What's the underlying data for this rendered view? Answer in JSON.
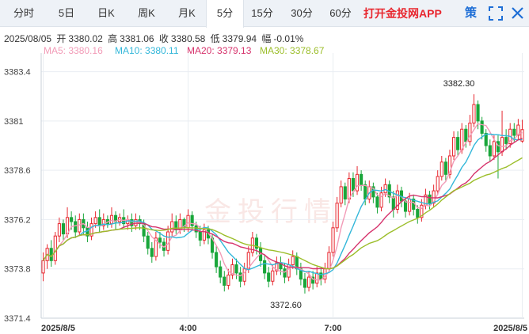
{
  "tabs": [
    "分时",
    "5日",
    "日K",
    "周K",
    "月K",
    "5分",
    "15分",
    "30分",
    "60分"
  ],
  "active_tab": "5分",
  "app_link": "打开金投网APP",
  "strategy_label": "策",
  "icons": {
    "fullscreen": "fullscreen-icon",
    "close": "close-icon"
  },
  "info": {
    "date": "2025/08/05",
    "open_label": "开",
    "open": "3380.02",
    "high_label": "高",
    "high": "3381.06",
    "close_label": "收",
    "close": "3380.58",
    "low_label": "低",
    "low": "3379.94",
    "change_label": "幅",
    "change": "-0.01%"
  },
  "ma": [
    {
      "label": "MA5:",
      "value": "3380.16",
      "color": "#f29bb7"
    },
    {
      "label": "MA10:",
      "value": "3380.11",
      "color": "#33b7d9"
    },
    {
      "label": "MA20:",
      "value": "3379.13",
      "color": "#d6336c"
    },
    {
      "label": "MA30:",
      "value": "3378.67",
      "color": "#9cbe2a"
    }
  ],
  "watermark": "金投行情",
  "colors": {
    "up": "#e8262e",
    "down": "#19a63a",
    "grid": "#e9edf2",
    "accent": "#1f6fd6"
  },
  "chart_data": {
    "type": "candlestick",
    "ylim": [
      3371.4,
      3384.0
    ],
    "y_ticks": [
      3383.4,
      3381,
      3378.6,
      3376.2,
      3373.8,
      3371.4
    ],
    "x_ticks": [
      {
        "label": "2025/8/5",
        "index": 0
      },
      {
        "label": "4:00",
        "index": 36
      },
      {
        "label": "7:00",
        "index": 72
      },
      {
        "label": "2025/8/5",
        "index": 119
      }
    ],
    "annotations": [
      {
        "text": "3382.30",
        "index": 108,
        "value": 3382.3,
        "side": "top"
      },
      {
        "text": "3372.60",
        "index": 65,
        "value": 3372.6,
        "side": "bottom"
      }
    ],
    "candles": [
      [
        3373.6,
        3374.2,
        3374.6,
        3373.2
      ],
      [
        3374.2,
        3374.8,
        3375.0,
        3373.8
      ],
      [
        3374.8,
        3374.2,
        3375.2,
        3373.9
      ],
      [
        3374.2,
        3375.4,
        3375.6,
        3374.0
      ],
      [
        3375.4,
        3376.0,
        3376.3,
        3375.1
      ],
      [
        3376.0,
        3375.5,
        3376.2,
        3375.2
      ],
      [
        3375.5,
        3376.3,
        3376.8,
        3375.3
      ],
      [
        3376.3,
        3376.1,
        3376.6,
        3375.7
      ],
      [
        3376.1,
        3375.6,
        3376.4,
        3375.3
      ],
      [
        3375.6,
        3376.2,
        3376.5,
        3375.4
      ],
      [
        3376.2,
        3375.8,
        3376.5,
        3375.5
      ],
      [
        3375.8,
        3375.4,
        3376.1,
        3375.1
      ],
      [
        3375.4,
        3376.0,
        3376.3,
        3375.2
      ],
      [
        3376.0,
        3376.3,
        3376.6,
        3375.8
      ],
      [
        3376.3,
        3375.9,
        3376.7,
        3375.6
      ],
      [
        3375.9,
        3376.2,
        3376.5,
        3375.7
      ],
      [
        3376.2,
        3376.0,
        3376.4,
        3375.8
      ],
      [
        3376.0,
        3376.4,
        3376.8,
        3375.8
      ],
      [
        3376.4,
        3376.1,
        3376.6,
        3375.7
      ],
      [
        3376.1,
        3376.3,
        3376.5,
        3375.9
      ],
      [
        3376.3,
        3376.0,
        3376.7,
        3375.8
      ],
      [
        3376.0,
        3376.2,
        3376.4,
        3375.7
      ],
      [
        3376.2,
        3375.9,
        3376.5,
        3375.6
      ],
      [
        3375.9,
        3376.2,
        3376.5,
        3375.7
      ],
      [
        3376.2,
        3376.0,
        3376.4,
        3375.7
      ],
      [
        3376.0,
        3375.4,
        3376.2,
        3375.1
      ],
      [
        3375.4,
        3374.8,
        3375.6,
        3374.5
      ],
      [
        3374.8,
        3374.4,
        3375.1,
        3374.1
      ],
      [
        3374.4,
        3375.3,
        3375.6,
        3374.2
      ],
      [
        3375.3,
        3375.1,
        3375.6,
        3374.8
      ],
      [
        3375.1,
        3374.7,
        3375.3,
        3374.4
      ],
      [
        3374.7,
        3375.6,
        3375.9,
        3374.5
      ],
      [
        3375.6,
        3376.1,
        3376.5,
        3375.4
      ],
      [
        3376.1,
        3375.7,
        3376.4,
        3375.5
      ],
      [
        3375.7,
        3376.2,
        3376.5,
        3375.5
      ],
      [
        3376.2,
        3375.8,
        3376.3,
        3375.6
      ],
      [
        3375.8,
        3376.4,
        3376.7,
        3375.6
      ],
      [
        3376.4,
        3375.9,
        3376.6,
        3375.7
      ],
      [
        3375.9,
        3375.6,
        3376.1,
        3375.3
      ],
      [
        3375.6,
        3375.2,
        3375.9,
        3374.9
      ],
      [
        3375.2,
        3375.7,
        3376.0,
        3375.0
      ],
      [
        3375.7,
        3375.3,
        3375.9,
        3375.0
      ],
      [
        3375.3,
        3374.6,
        3375.5,
        3374.3
      ],
      [
        3374.6,
        3373.9,
        3374.9,
        3373.6
      ],
      [
        3373.9,
        3373.4,
        3374.2,
        3373.1
      ],
      [
        3373.4,
        3373.0,
        3373.7,
        3372.7
      ],
      [
        3373.0,
        3373.5,
        3373.8,
        3372.8
      ],
      [
        3373.5,
        3374.0,
        3374.3,
        3373.3
      ],
      [
        3374.0,
        3373.6,
        3374.3,
        3373.3
      ],
      [
        3373.6,
        3373.2,
        3373.9,
        3372.9
      ],
      [
        3373.2,
        3373.8,
        3374.1,
        3373.0
      ],
      [
        3373.8,
        3374.6,
        3374.9,
        3373.6
      ],
      [
        3374.6,
        3375.3,
        3375.6,
        3374.4
      ],
      [
        3375.3,
        3374.8,
        3375.5,
        3374.5
      ],
      [
        3374.8,
        3374.2,
        3375.1,
        3373.9
      ],
      [
        3374.2,
        3373.6,
        3374.5,
        3373.3
      ],
      [
        3373.6,
        3373.2,
        3373.9,
        3372.9
      ],
      [
        3373.2,
        3373.7,
        3374.0,
        3373.0
      ],
      [
        3373.7,
        3374.1,
        3374.4,
        3373.5
      ],
      [
        3374.1,
        3373.8,
        3374.4,
        3373.5
      ],
      [
        3373.8,
        3373.4,
        3374.1,
        3373.1
      ],
      [
        3373.4,
        3374.0,
        3374.3,
        3373.2
      ],
      [
        3374.0,
        3374.4,
        3374.7,
        3373.8
      ],
      [
        3374.4,
        3373.8,
        3374.6,
        3373.5
      ],
      [
        3373.8,
        3373.3,
        3374.1,
        3373.0
      ],
      [
        3373.3,
        3372.9,
        3373.6,
        3372.6
      ],
      [
        3372.9,
        3373.4,
        3373.7,
        3372.7
      ],
      [
        3373.4,
        3373.1,
        3373.7,
        3372.8
      ],
      [
        3373.1,
        3373.6,
        3373.9,
        3372.9
      ],
      [
        3373.6,
        3373.3,
        3373.9,
        3373.0
      ],
      [
        3373.3,
        3373.8,
        3374.1,
        3373.1
      ],
      [
        3373.8,
        3374.6,
        3374.9,
        3373.6
      ],
      [
        3374.6,
        3375.8,
        3376.1,
        3374.4
      ],
      [
        3375.8,
        3377.0,
        3377.3,
        3375.6
      ],
      [
        3377.0,
        3377.8,
        3378.1,
        3376.8
      ],
      [
        3377.8,
        3377.2,
        3378.0,
        3376.9
      ],
      [
        3377.2,
        3378.2,
        3378.5,
        3377.0
      ],
      [
        3378.2,
        3377.6,
        3378.5,
        3377.3
      ],
      [
        3377.6,
        3378.4,
        3378.8,
        3377.4
      ],
      [
        3378.4,
        3377.9,
        3378.6,
        3377.6
      ],
      [
        3377.9,
        3377.2,
        3378.1,
        3376.9
      ],
      [
        3377.2,
        3377.8,
        3378.1,
        3377.0
      ],
      [
        3377.8,
        3377.3,
        3378.0,
        3377.0
      ],
      [
        3377.3,
        3376.8,
        3377.5,
        3376.5
      ],
      [
        3376.8,
        3377.5,
        3377.8,
        3376.6
      ],
      [
        3377.5,
        3377.9,
        3378.2,
        3377.3
      ],
      [
        3377.9,
        3377.3,
        3378.1,
        3377.0
      ],
      [
        3377.3,
        3376.7,
        3377.6,
        3376.3
      ],
      [
        3376.7,
        3377.6,
        3377.9,
        3376.5
      ],
      [
        3377.6,
        3377.1,
        3377.8,
        3376.8
      ],
      [
        3377.1,
        3376.6,
        3377.3,
        3376.3
      ],
      [
        3376.6,
        3377.2,
        3377.5,
        3376.4
      ],
      [
        3377.2,
        3376.7,
        3377.4,
        3376.4
      ],
      [
        3376.7,
        3376.3,
        3376.9,
        3376.0
      ],
      [
        3376.3,
        3376.9,
        3377.2,
        3376.1
      ],
      [
        3376.9,
        3377.4,
        3377.7,
        3376.7
      ],
      [
        3377.4,
        3377.0,
        3377.6,
        3376.7
      ],
      [
        3377.0,
        3377.6,
        3377.9,
        3376.8
      ],
      [
        3377.6,
        3378.3,
        3378.6,
        3377.4
      ],
      [
        3378.3,
        3379.0,
        3379.3,
        3378.1
      ],
      [
        3379.0,
        3378.4,
        3379.2,
        3378.1
      ],
      [
        3378.4,
        3379.3,
        3379.6,
        3378.2
      ],
      [
        3379.3,
        3380.2,
        3380.5,
        3379.1
      ],
      [
        3380.2,
        3379.6,
        3380.5,
        3379.3
      ],
      [
        3379.6,
        3380.6,
        3380.9,
        3379.4
      ],
      [
        3380.6,
        3380.0,
        3380.8,
        3379.7
      ],
      [
        3380.0,
        3380.9,
        3381.3,
        3379.8
      ],
      [
        3380.9,
        3381.8,
        3382.3,
        3380.7
      ],
      [
        3381.8,
        3381.0,
        3382.0,
        3380.6
      ],
      [
        3381.0,
        3380.4,
        3381.2,
        3380.1
      ],
      [
        3380.4,
        3379.8,
        3380.6,
        3379.5
      ],
      [
        3379.8,
        3379.3,
        3380.1,
        3379.0
      ],
      [
        3379.3,
        3380.0,
        3380.3,
        3379.1
      ],
      [
        3380.0,
        3379.5,
        3380.3,
        3378.2
      ],
      [
        3379.5,
        3380.2,
        3381.5,
        3379.3
      ],
      [
        3380.2,
        3379.9,
        3380.6,
        3379.6
      ],
      [
        3379.9,
        3380.6,
        3380.9,
        3379.7
      ],
      [
        3380.6,
        3380.3,
        3380.9,
        3380.0
      ],
      [
        3380.3,
        3380.8,
        3381.1,
        3380.1
      ],
      [
        3380.02,
        3380.58,
        3381.06,
        3379.94
      ]
    ]
  }
}
